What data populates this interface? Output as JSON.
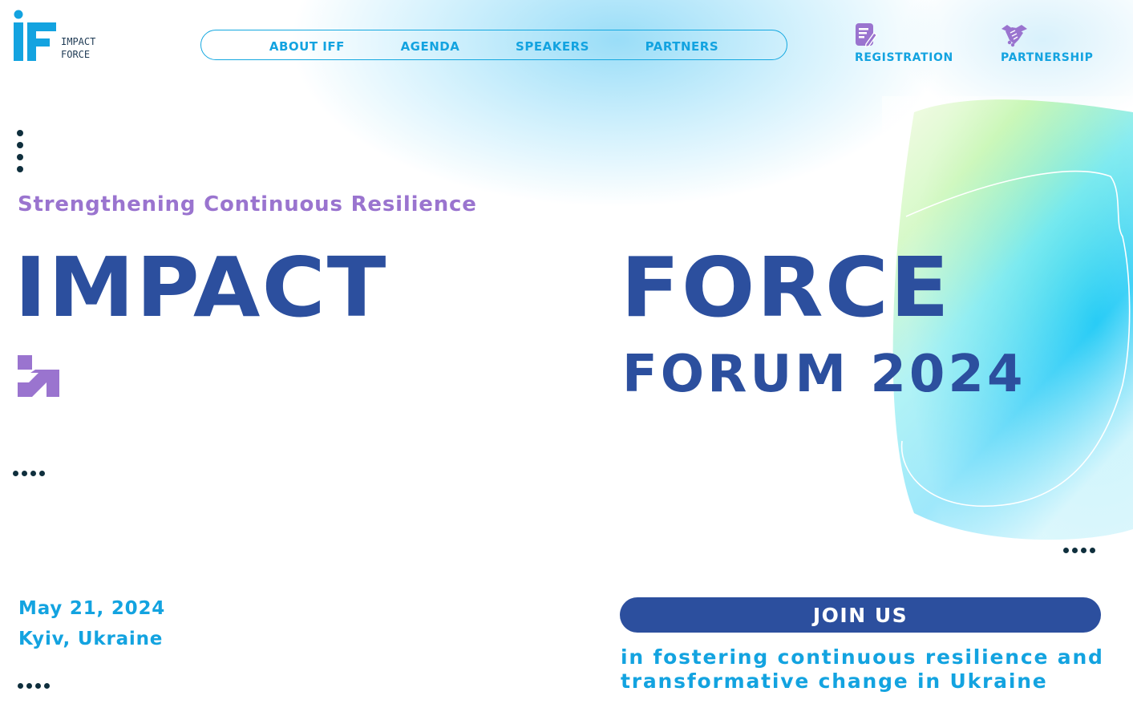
{
  "logo": {
    "line1": "IMPACT",
    "line2": "FORCE",
    "mark": "iF"
  },
  "nav": {
    "items": [
      {
        "label": "ABOUT IFF"
      },
      {
        "label": "AGENDA"
      },
      {
        "label": "SPEAKERS"
      },
      {
        "label": "PARTNERS"
      }
    ]
  },
  "actions": {
    "registration": {
      "label": "REGISTRATION",
      "icon": "form-edit-icon"
    },
    "partnership": {
      "label": "PARTNERSHIP",
      "icon": "handshake-icon"
    }
  },
  "hero": {
    "subtitle": "Strengthening Continuous Resilience",
    "title_left": "IMPACT",
    "title_right": "FORCE",
    "forum": "FORUM 2024"
  },
  "event": {
    "date": "May 21, 2024",
    "location": "Kyiv, Ukraine"
  },
  "cta": {
    "join_label": "JOIN US",
    "tagline_line1": "in fostering continuous resilience and",
    "tagline_line2": "transformative change in Ukraine"
  },
  "colors": {
    "primary": "#2c4f9e",
    "accent_blue": "#13a3e0",
    "accent_purple": "#9a74cf",
    "dots": "#0f2f3d"
  }
}
